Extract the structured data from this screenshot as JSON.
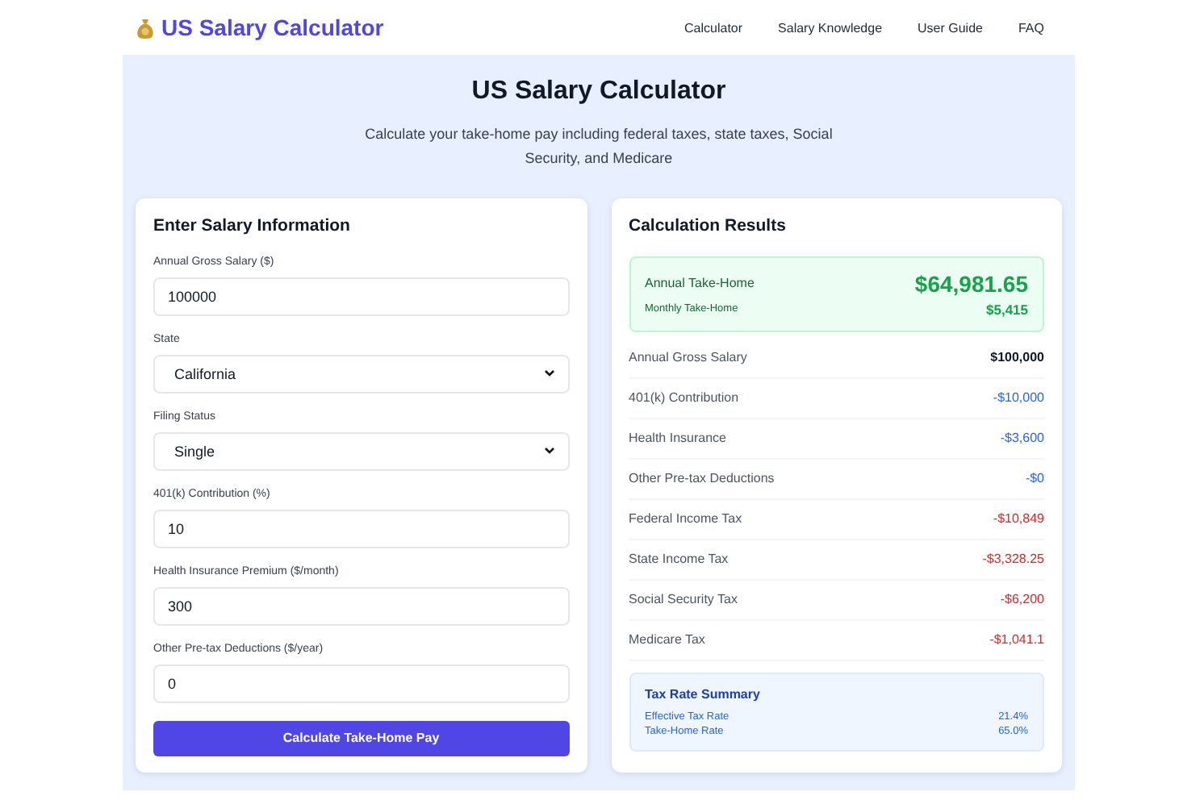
{
  "brand": "US Salary Calculator",
  "nav": [
    "Calculator",
    "Salary Knowledge",
    "User Guide",
    "FAQ"
  ],
  "hero": {
    "title": "US Salary Calculator",
    "subtitle": "Calculate your take-home pay including federal taxes, state taxes, Social Security, and Medicare"
  },
  "form": {
    "title": "Enter Salary Information",
    "fields": [
      {
        "label": "Annual Gross Salary ($)",
        "kind": "input",
        "value": "100000"
      },
      {
        "label": "State",
        "kind": "select",
        "value": "California"
      },
      {
        "label": "Filing Status",
        "kind": "select",
        "value": "Single"
      },
      {
        "label": "401(k) Contribution (%)",
        "kind": "input",
        "value": "10"
      },
      {
        "label": "Health Insurance Premium ($/month)",
        "kind": "input",
        "value": "300"
      },
      {
        "label": "Other Pre-tax Deductions ($/year)",
        "kind": "input",
        "value": "0"
      }
    ],
    "button": "Calculate Take-Home Pay"
  },
  "results": {
    "title": "Calculation Results",
    "annual": {
      "label": "Annual Take-Home",
      "value": "$64,981.65"
    },
    "monthly": {
      "label": "Monthly Take-Home",
      "value": "$5,415"
    },
    "rows": [
      {
        "label": "Annual Gross Salary",
        "value": "$100,000",
        "kind": "gross"
      },
      {
        "label": "401(k) Contribution",
        "value": "-$10,000",
        "kind": "deduction"
      },
      {
        "label": "Health Insurance",
        "value": "-$3,600",
        "kind": "deduction"
      },
      {
        "label": "Other Pre-tax Deductions",
        "value": "-$0",
        "kind": "deduction"
      },
      {
        "label": "Federal Income Tax",
        "value": "-$10,849",
        "kind": "tax"
      },
      {
        "label": "State Income Tax",
        "value": "-$3,328.25",
        "kind": "tax"
      },
      {
        "label": "Social Security Tax",
        "value": "-$6,200",
        "kind": "tax"
      },
      {
        "label": "Medicare Tax",
        "value": "-$1,041.1",
        "kind": "tax"
      }
    ],
    "summary": {
      "title": "Tax Rate Summary",
      "rows": [
        {
          "label": "Effective Tax Rate",
          "value": "21.4%"
        },
        {
          "label": "Take-Home Rate",
          "value": "65.0%"
        }
      ]
    }
  }
}
